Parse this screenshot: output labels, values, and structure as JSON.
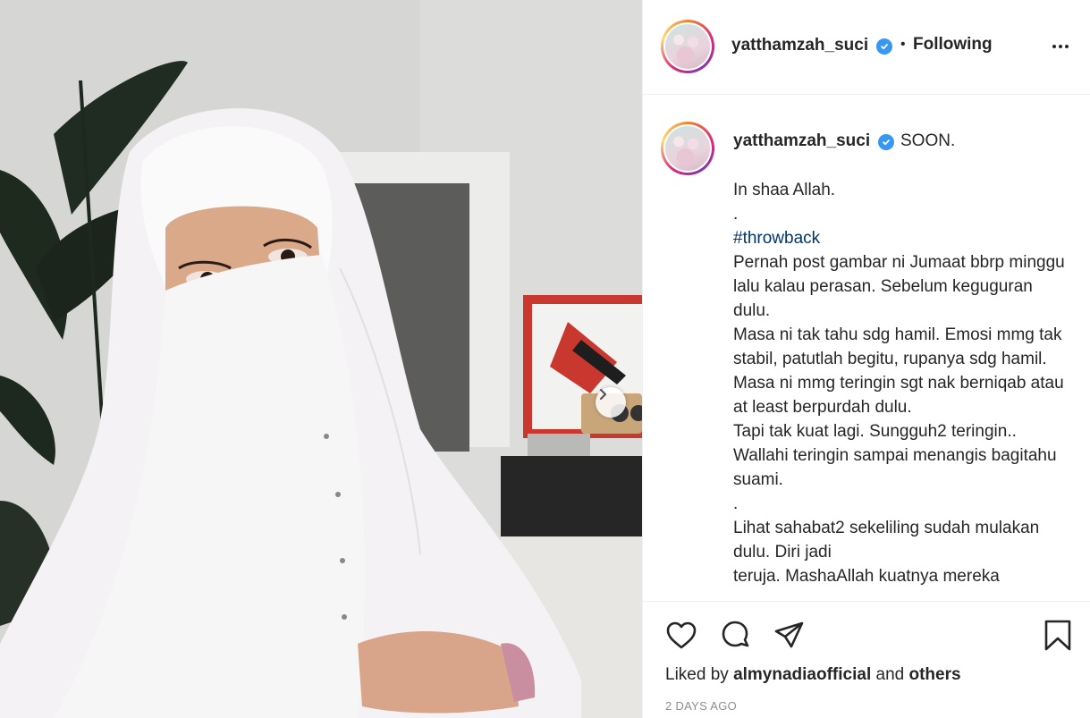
{
  "post": {
    "username": "yatthamzah_suci",
    "follow_status": "Following",
    "separator": "•",
    "verified_icon": "verified-badge-icon",
    "more_icon": "more-options-icon"
  },
  "caption": {
    "username": "yatthamzah_suci",
    "first_line": "SOON.",
    "lines_before_hashtag": "In shaa Allah.\n.\n",
    "hashtag": "#throwback",
    "lines_after_hashtag": "\nPernah post gambar ni Jumaat bbrp minggu lalu kalau perasan. Sebelum keguguran dulu.\nMasa ni tak tahu sdg hamil. Emosi mmg tak stabil, patutlah begitu, rupanya sdg hamil.\nMasa ni mmg teringin sgt nak berniqab atau at least berpurdah dulu.\nTapi tak kuat lagi. Sungguh2 teringin..\nWallahi teringin sampai menangis bagitahu suami.\n.\nLihat sahabat2 sekeliling sudah mulakan dulu. Diri jadi\nteruja. MashaAllah kuatnya mereka"
  },
  "actions": {
    "like_icon": "heart-icon",
    "comment_icon": "comment-icon",
    "share_icon": "share-icon",
    "save_icon": "bookmark-icon"
  },
  "likes": {
    "prefix": "Liked by",
    "user": "almynadiaofficial",
    "conjunction": "and",
    "others": "others"
  },
  "timestamp": "2 DAYS AGO",
  "photo": {
    "next_icon": "chevron-right-icon"
  },
  "colors": {
    "link": "#003569",
    "verified": "#3897f0",
    "muted": "#8e8e8e",
    "text": "#262626"
  }
}
